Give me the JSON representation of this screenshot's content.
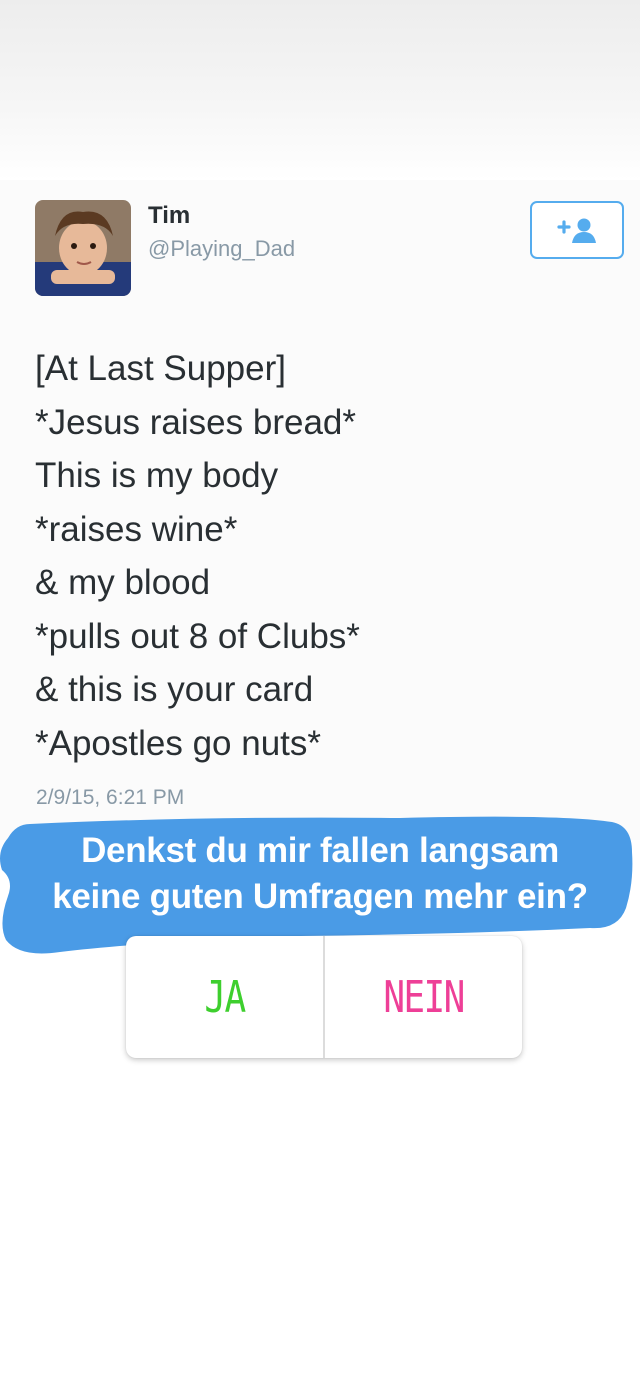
{
  "tweet": {
    "user_name": "Tim",
    "user_handle": "@Playing_Dad",
    "follow_icon": "add-user-icon",
    "lines": [
      "[At Last Supper]",
      "*Jesus raises bread*",
      "This is my body",
      "*raises wine*",
      "& my blood",
      "*pulls out 8 of Clubs*",
      "& this is your card",
      "*Apostles go nuts*"
    ],
    "timestamp": "2/9/15, 6:21 PM"
  },
  "question": {
    "line1": "Denkst du mir fallen langsam",
    "line2": "keine guten Umfragen mehr ein?",
    "background_color": "#4a9be6"
  },
  "poll": {
    "options": [
      {
        "label": "JA",
        "color": "#3ecf2e"
      },
      {
        "label": "NEIN",
        "color": "#ee3f97"
      }
    ]
  }
}
